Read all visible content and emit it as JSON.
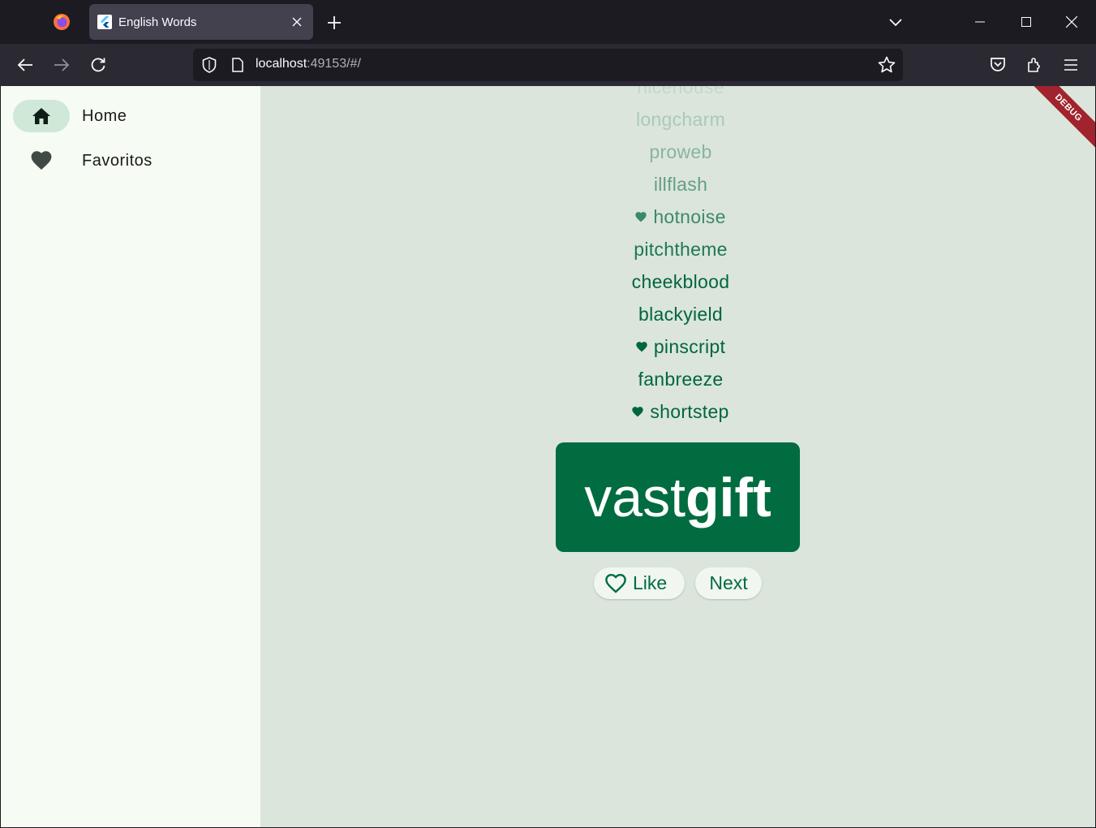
{
  "browser": {
    "tab_title": "English Words",
    "url_host": "localhost",
    "url_rest": ":49153/#/"
  },
  "rail": {
    "items": [
      {
        "label": "Home",
        "icon": "home-icon",
        "active": true
      },
      {
        "label": "Favoritos",
        "icon": "heart-icon",
        "active": false
      }
    ]
  },
  "history": [
    {
      "word": "nicehouse",
      "favorite": false
    },
    {
      "word": "longcharm",
      "favorite": false
    },
    {
      "word": "proweb",
      "favorite": false
    },
    {
      "word": "illflash",
      "favorite": false
    },
    {
      "word": "hotnoise",
      "favorite": true
    },
    {
      "word": "pitchtheme",
      "favorite": false
    },
    {
      "word": "cheekblood",
      "favorite": false
    },
    {
      "word": "blackyield",
      "favorite": false
    },
    {
      "word": "pinscript",
      "favorite": true
    },
    {
      "word": "fanbreeze",
      "favorite": false
    },
    {
      "word": "shortstep",
      "favorite": true
    }
  ],
  "current_pair": {
    "first": "vast",
    "second": "gift"
  },
  "buttons": {
    "like": "Like",
    "next": "Next"
  },
  "debug_banner": "DEBUG",
  "colors": {
    "primary": "#006c3f",
    "background": "#dbe5dc",
    "rail_bg": "#f6fbf3",
    "rail_indicator": "#cfe8d8",
    "debug": "#a1232d"
  }
}
